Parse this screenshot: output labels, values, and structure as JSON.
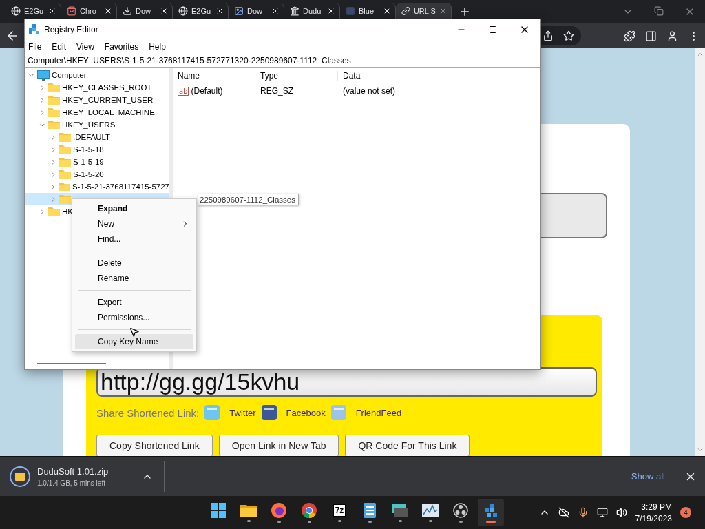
{
  "browser": {
    "tabs": [
      {
        "title": "E2Gu",
        "kind": "globe",
        "selected": false
      },
      {
        "title": "Chro",
        "kind": "store",
        "selected": false
      },
      {
        "title": "Dow",
        "kind": "download",
        "selected": false
      },
      {
        "title": "E2Gu",
        "kind": "globe",
        "selected": false
      },
      {
        "title": "Dow",
        "kind": "picture",
        "selected": false
      },
      {
        "title": "Dudu",
        "kind": "bank",
        "selected": false
      },
      {
        "title": "Blue",
        "kind": "square",
        "selected": false
      },
      {
        "title": "URL S",
        "kind": "link",
        "selected": true
      }
    ]
  },
  "page": {
    "short_url": "http://gg.gg/15kvhu",
    "share_label": "Share Shortened Link:",
    "share_links": [
      {
        "label": "Twitter",
        "kind": "twitter"
      },
      {
        "label": "Facebook",
        "kind": "facebook"
      },
      {
        "label": "FriendFeed",
        "kind": "friendfeed"
      }
    ],
    "buttons": [
      "Copy Shortened Link",
      "Open Link in New Tab",
      "QR Code For This Link"
    ]
  },
  "registry": {
    "title": "Registry Editor",
    "menu": [
      "File",
      "Edit",
      "View",
      "Favorites",
      "Help"
    ],
    "address": "Computer\\HKEY_USERS\\S-1-5-21-3768117415-572771320-2250989607-1112_Classes",
    "tree": [
      {
        "label": "Computer",
        "kind": "computer",
        "expanded": true,
        "selected": false,
        "children": [
          {
            "label": "HKEY_CLASSES_ROOT",
            "kind": "folder",
            "expanded": false,
            "selected": false
          },
          {
            "label": "HKEY_CURRENT_USER",
            "kind": "folder",
            "expanded": false,
            "selected": false
          },
          {
            "label": "HKEY_LOCAL_MACHINE",
            "kind": "folder",
            "expanded": false,
            "selected": false
          },
          {
            "label": "HKEY_USERS",
            "kind": "folder",
            "expanded": true,
            "selected": false,
            "children": [
              {
                "label": ".DEFAULT",
                "kind": "folder",
                "expanded": false,
                "selected": false
              },
              {
                "label": "S-1-5-18",
                "kind": "folder",
                "expanded": false,
                "selected": false
              },
              {
                "label": "S-1-5-19",
                "kind": "folder",
                "expanded": false,
                "selected": false
              },
              {
                "label": "S-1-5-20",
                "kind": "folder",
                "expanded": false,
                "selected": false
              },
              {
                "label": "S-1-5-21-3768117415-5727",
                "kind": "folder",
                "expanded": false,
                "selected": false
              },
              {
                "kind": "folder",
                "expanded": false,
                "selected": true
              }
            ]
          },
          {
            "label": "HK",
            "kind": "folder",
            "expanded": false,
            "selected": false
          }
        ]
      }
    ],
    "columns": [
      "Name",
      "Type",
      "Data"
    ],
    "values": [
      {
        "badge": "ab",
        "name": "(Default)",
        "type": "REG_SZ",
        "data": "(value not set)"
      }
    ],
    "tooltip": "2250989607-1112_Classes"
  },
  "context_menu": {
    "groups": [
      [
        {
          "label": "Expand",
          "kind": "default",
          "selected": false
        },
        {
          "label": "New",
          "kind": "submenu",
          "selected": false
        },
        {
          "label": "Find...",
          "kind": "plain",
          "selected": false
        }
      ],
      [
        {
          "label": "Delete",
          "kind": "plain",
          "selected": false
        },
        {
          "label": "Rename",
          "kind": "plain",
          "selected": false
        }
      ],
      [
        {
          "label": "Export",
          "kind": "plain",
          "selected": false
        },
        {
          "label": "Permissions...",
          "kind": "plain",
          "selected": false
        }
      ],
      [
        {
          "label": "Copy Key Name",
          "kind": "plain",
          "selected": true
        }
      ]
    ]
  },
  "downloads": {
    "file": "DuduSoft 1.01.zip",
    "status": "1.0/1.4 GB, 5 mins left",
    "show_all": "Show all"
  },
  "taskbar": {
    "apps": [
      {
        "kind": "start",
        "running": false,
        "selected": false
      },
      {
        "kind": "explorer",
        "running": true,
        "selected": false
      },
      {
        "kind": "firefox",
        "running": true,
        "selected": false
      },
      {
        "kind": "chrome",
        "running": true,
        "selected": false
      },
      {
        "kind": "archiver",
        "label": "7z",
        "running": true,
        "selected": false
      },
      {
        "kind": "notepad",
        "running": true,
        "selected": false
      },
      {
        "kind": "remote",
        "running": true,
        "selected": false
      },
      {
        "kind": "monitor",
        "running": true,
        "selected": false
      },
      {
        "kind": "obs",
        "running": true,
        "selected": false
      },
      {
        "kind": "registry",
        "running": true,
        "selected": true
      }
    ],
    "time": "3:29 PM",
    "date": "7/19/2023",
    "notifications": "4"
  }
}
